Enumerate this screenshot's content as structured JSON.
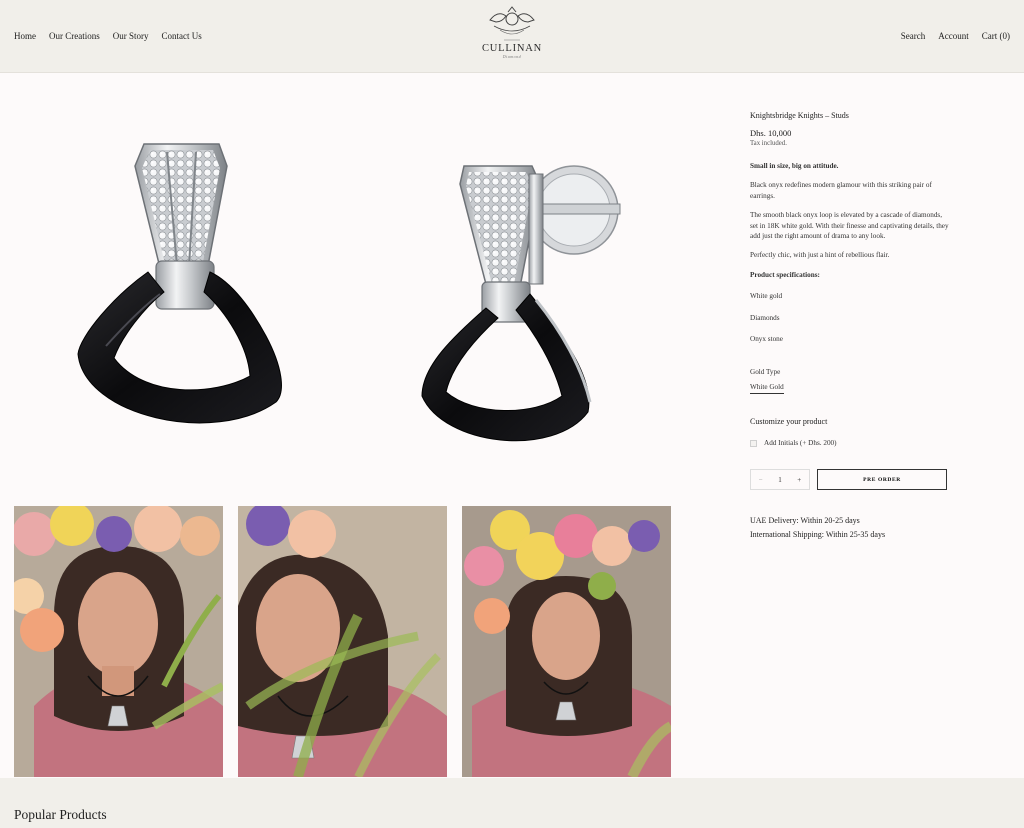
{
  "header": {
    "nav_left": [
      "Home",
      "Our Creations",
      "Our Story",
      "Contact Us"
    ],
    "nav_right": [
      "Search",
      "Account",
      "Cart (0)"
    ],
    "logo": {
      "name": "CULLINAN",
      "est": "EST. 1998",
      "sub": "Diamond"
    }
  },
  "product": {
    "title": "Knightsbridge Knights – Studs",
    "price": "Dhs. 10,000",
    "tax": "Tax included.",
    "tagline": "Small in size, big on attitude.",
    "para1": "Black onyx redefines modern glamour with this striking pair of earrings.",
    "para2": "The smooth black onyx loop is elevated by a cascade of diamonds, set in 18K white gold. With their finesse and captivating details, they add just the right amount of drama to any look.",
    "para3": "Perfectly chic, with just a hint of rebellious flair.",
    "specs_heading": "Product specifications:",
    "specs": [
      "White gold",
      "Diamonds",
      "Onyx stone"
    ],
    "gold_type_label": "Gold Type",
    "gold_type_value": "White Gold",
    "customize_heading": "Customize your product",
    "initials_option": "Add Initials (+ Dhs. 200)",
    "quantity": "1",
    "minus": "−",
    "plus": "+",
    "preorder_label": "PRE ORDER",
    "delivery_uae": "UAE Delivery: Within 20-25 days",
    "delivery_intl": "International Shipping: Within 25-35 days"
  },
  "footer": {
    "popular_heading": "Popular Products"
  },
  "colors": {
    "header_bg": "#f1efea",
    "page_bg": "#fdfafa",
    "onyx": "#0f0f12",
    "skin": "#d9a48a",
    "top": "#c2737f"
  }
}
